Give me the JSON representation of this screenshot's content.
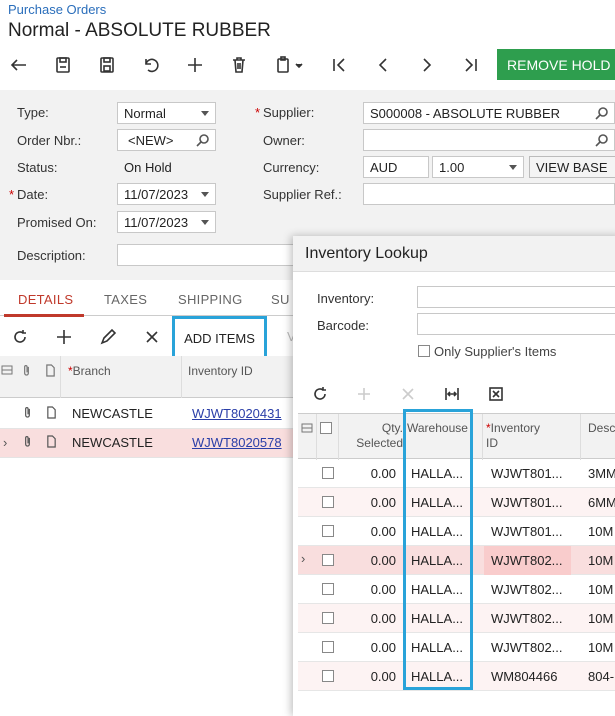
{
  "breadcrumb": "Purchase Orders",
  "page_title": "Normal - ABSOLUTE RUBBER",
  "toolbar": {
    "remove_hold_label": "REMOVE HOLD"
  },
  "form": {
    "type_label": "Type:",
    "type_value": "Normal",
    "order_nbr_label": "Order Nbr.:",
    "order_nbr_value": "<NEW>",
    "status_label": "Status:",
    "status_value": "On Hold",
    "date_label": "Date:",
    "date_value": "11/07/2023",
    "promised_on_label": "Promised On:",
    "promised_on_value": "11/07/2023",
    "description_label": "Description:",
    "supplier_label": "Supplier:",
    "supplier_value": "S000008 - ABSOLUTE RUBBER",
    "owner_label": "Owner:",
    "currency_label": "Currency:",
    "currency_value": "AUD",
    "rate_value": "1.00",
    "view_base_label": "VIEW BASE",
    "supplier_ref_label": "Supplier Ref.:"
  },
  "tabs": [
    "DETAILS",
    "TAXES",
    "SHIPPING",
    "SU"
  ],
  "grid_toolbar": {
    "add_items_label": "ADD ITEMS",
    "partial": "V"
  },
  "grid": {
    "columns": {
      "branch": "Branch",
      "inventory_id": "Inventory ID"
    },
    "rows": [
      {
        "branch": "NEWCASTLE",
        "inventory_id": "WJWT8020431"
      },
      {
        "branch": "NEWCASTLE",
        "inventory_id": "WJWT8020578"
      }
    ]
  },
  "modal": {
    "title": "Inventory Lookup",
    "inventory_label": "Inventory:",
    "barcode_label": "Barcode:",
    "only_supplier_label": "Only Supplier's Items",
    "columns": {
      "qty_line1": "Qty.",
      "qty_line2": "Selected",
      "warehouse": "Warehouse",
      "inv_line1": "Inventory",
      "inv_line2": "ID",
      "desc": "Descr"
    },
    "rows": [
      {
        "qty": "0.00",
        "wh": "HALLA...",
        "inv": "WJWT801...",
        "desc": "3MM"
      },
      {
        "qty": "0.00",
        "wh": "HALLA...",
        "inv": "WJWT801...",
        "desc": "6MM"
      },
      {
        "qty": "0.00",
        "wh": "HALLA...",
        "inv": "WJWT801...",
        "desc": "10M"
      },
      {
        "qty": "0.00",
        "wh": "HALLA...",
        "inv": "WJWT802...",
        "desc": "10M"
      },
      {
        "qty": "0.00",
        "wh": "HALLA...",
        "inv": "WJWT802...",
        "desc": "10M"
      },
      {
        "qty": "0.00",
        "wh": "HALLA...",
        "inv": "WJWT802...",
        "desc": "10M"
      },
      {
        "qty": "0.00",
        "wh": "HALLA...",
        "inv": "WJWT802...",
        "desc": "10M"
      },
      {
        "qty": "0.00",
        "wh": "HALLA...",
        "inv": "WM804466",
        "desc": "804-"
      }
    ]
  }
}
